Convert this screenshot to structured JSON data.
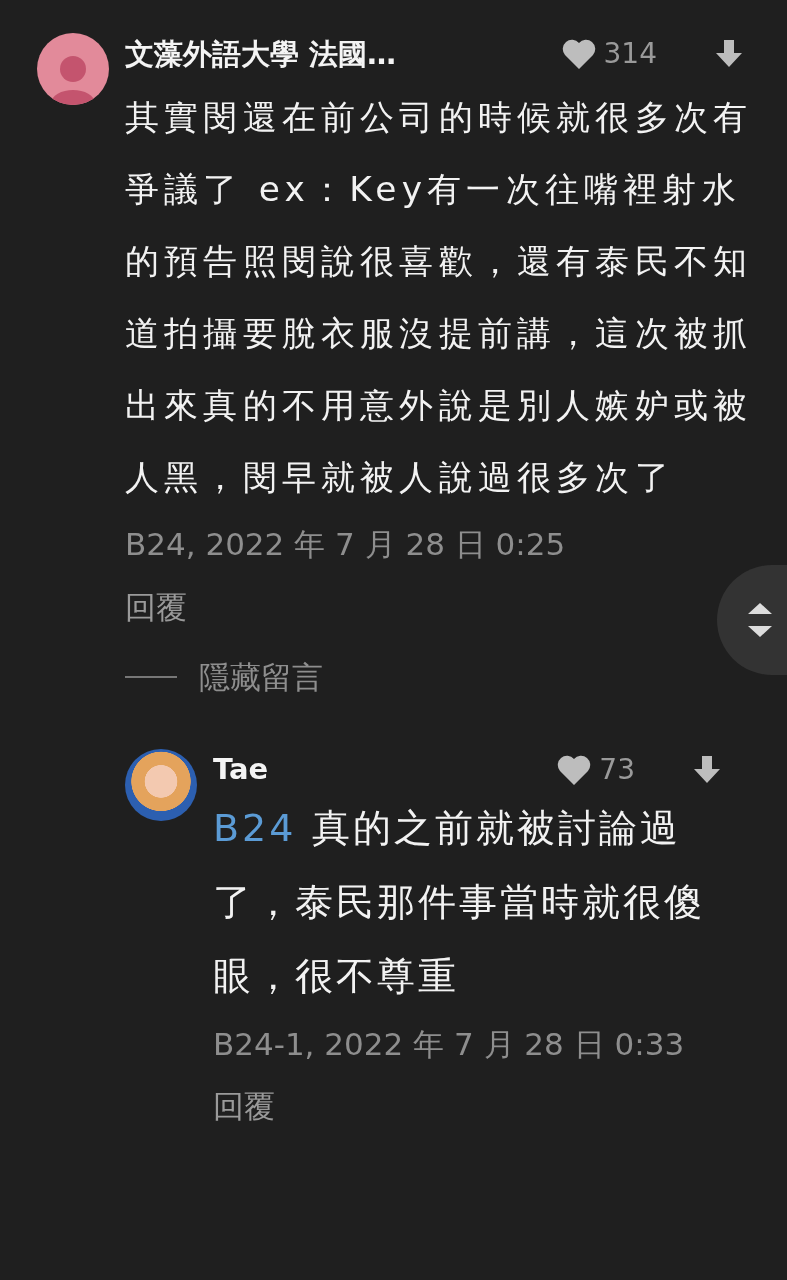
{
  "comments": [
    {
      "author": "文藻外語大學 法國…",
      "likes": "314",
      "body": "其實閔還在前公司的時候就很多次有爭議了 ex：Key有一次往嘴裡射水的預告照閔說很喜歡，還有泰民不知道拍攝要脫衣服沒提前講，這次被抓出來真的不用意外說是別人嫉妒或被人黑，閔早就被人說過很多次了",
      "meta": "B24, 2022 年 7 月 28 日 0:25",
      "reply_label": "回覆",
      "hide_label": "隱藏留言",
      "replies": [
        {
          "author": "Tae",
          "likes": "73",
          "mention": "B24",
          "body": "真的之前就被討論過了，泰民那件事當時就很傻眼，很不尊重",
          "meta": "B24-1, 2022 年 7 月 28 日 0:33",
          "reply_label": "回覆"
        }
      ]
    }
  ]
}
